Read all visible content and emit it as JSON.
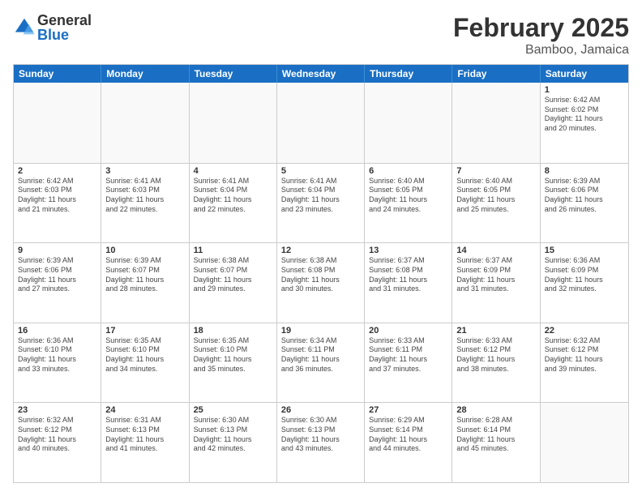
{
  "logo": {
    "general": "General",
    "blue": "Blue"
  },
  "title": "February 2025",
  "location": "Bamboo, Jamaica",
  "days_of_week": [
    "Sunday",
    "Monday",
    "Tuesday",
    "Wednesday",
    "Thursday",
    "Friday",
    "Saturday"
  ],
  "rows": [
    [
      {
        "day": "",
        "info": ""
      },
      {
        "day": "",
        "info": ""
      },
      {
        "day": "",
        "info": ""
      },
      {
        "day": "",
        "info": ""
      },
      {
        "day": "",
        "info": ""
      },
      {
        "day": "",
        "info": ""
      },
      {
        "day": "1",
        "info": "Sunrise: 6:42 AM\nSunset: 6:02 PM\nDaylight: 11 hours\nand 20 minutes."
      }
    ],
    [
      {
        "day": "2",
        "info": "Sunrise: 6:42 AM\nSunset: 6:03 PM\nDaylight: 11 hours\nand 21 minutes."
      },
      {
        "day": "3",
        "info": "Sunrise: 6:41 AM\nSunset: 6:03 PM\nDaylight: 11 hours\nand 22 minutes."
      },
      {
        "day": "4",
        "info": "Sunrise: 6:41 AM\nSunset: 6:04 PM\nDaylight: 11 hours\nand 22 minutes."
      },
      {
        "day": "5",
        "info": "Sunrise: 6:41 AM\nSunset: 6:04 PM\nDaylight: 11 hours\nand 23 minutes."
      },
      {
        "day": "6",
        "info": "Sunrise: 6:40 AM\nSunset: 6:05 PM\nDaylight: 11 hours\nand 24 minutes."
      },
      {
        "day": "7",
        "info": "Sunrise: 6:40 AM\nSunset: 6:05 PM\nDaylight: 11 hours\nand 25 minutes."
      },
      {
        "day": "8",
        "info": "Sunrise: 6:39 AM\nSunset: 6:06 PM\nDaylight: 11 hours\nand 26 minutes."
      }
    ],
    [
      {
        "day": "9",
        "info": "Sunrise: 6:39 AM\nSunset: 6:06 PM\nDaylight: 11 hours\nand 27 minutes."
      },
      {
        "day": "10",
        "info": "Sunrise: 6:39 AM\nSunset: 6:07 PM\nDaylight: 11 hours\nand 28 minutes."
      },
      {
        "day": "11",
        "info": "Sunrise: 6:38 AM\nSunset: 6:07 PM\nDaylight: 11 hours\nand 29 minutes."
      },
      {
        "day": "12",
        "info": "Sunrise: 6:38 AM\nSunset: 6:08 PM\nDaylight: 11 hours\nand 30 minutes."
      },
      {
        "day": "13",
        "info": "Sunrise: 6:37 AM\nSunset: 6:08 PM\nDaylight: 11 hours\nand 31 minutes."
      },
      {
        "day": "14",
        "info": "Sunrise: 6:37 AM\nSunset: 6:09 PM\nDaylight: 11 hours\nand 31 minutes."
      },
      {
        "day": "15",
        "info": "Sunrise: 6:36 AM\nSunset: 6:09 PM\nDaylight: 11 hours\nand 32 minutes."
      }
    ],
    [
      {
        "day": "16",
        "info": "Sunrise: 6:36 AM\nSunset: 6:10 PM\nDaylight: 11 hours\nand 33 minutes."
      },
      {
        "day": "17",
        "info": "Sunrise: 6:35 AM\nSunset: 6:10 PM\nDaylight: 11 hours\nand 34 minutes."
      },
      {
        "day": "18",
        "info": "Sunrise: 6:35 AM\nSunset: 6:10 PM\nDaylight: 11 hours\nand 35 minutes."
      },
      {
        "day": "19",
        "info": "Sunrise: 6:34 AM\nSunset: 6:11 PM\nDaylight: 11 hours\nand 36 minutes."
      },
      {
        "day": "20",
        "info": "Sunrise: 6:33 AM\nSunset: 6:11 PM\nDaylight: 11 hours\nand 37 minutes."
      },
      {
        "day": "21",
        "info": "Sunrise: 6:33 AM\nSunset: 6:12 PM\nDaylight: 11 hours\nand 38 minutes."
      },
      {
        "day": "22",
        "info": "Sunrise: 6:32 AM\nSunset: 6:12 PM\nDaylight: 11 hours\nand 39 minutes."
      }
    ],
    [
      {
        "day": "23",
        "info": "Sunrise: 6:32 AM\nSunset: 6:12 PM\nDaylight: 11 hours\nand 40 minutes."
      },
      {
        "day": "24",
        "info": "Sunrise: 6:31 AM\nSunset: 6:13 PM\nDaylight: 11 hours\nand 41 minutes."
      },
      {
        "day": "25",
        "info": "Sunrise: 6:30 AM\nSunset: 6:13 PM\nDaylight: 11 hours\nand 42 minutes."
      },
      {
        "day": "26",
        "info": "Sunrise: 6:30 AM\nSunset: 6:13 PM\nDaylight: 11 hours\nand 43 minutes."
      },
      {
        "day": "27",
        "info": "Sunrise: 6:29 AM\nSunset: 6:14 PM\nDaylight: 11 hours\nand 44 minutes."
      },
      {
        "day": "28",
        "info": "Sunrise: 6:28 AM\nSunset: 6:14 PM\nDaylight: 11 hours\nand 45 minutes."
      },
      {
        "day": "",
        "info": ""
      }
    ]
  ]
}
